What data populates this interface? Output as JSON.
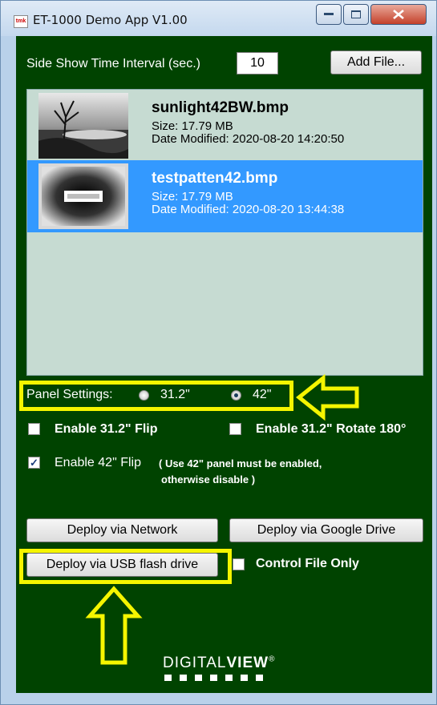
{
  "window": {
    "title": "ET-1000 Demo App V1.00",
    "app_icon_text": "tmk"
  },
  "interval": {
    "label": "Side Show Time Interval (sec.)",
    "value": "10"
  },
  "add_file_label": "Add File...",
  "files": [
    {
      "name": "sunlight42BW.bmp",
      "size": "Size: 17.79 MB",
      "date": "Date Modified: 2020-08-20 14:20:50",
      "selected": false
    },
    {
      "name": "testpatten42.bmp",
      "size": "Size: 17.79 MB",
      "date": "Date Modified: 2020-08-20 13:44:38",
      "selected": true
    }
  ],
  "panel": {
    "label": "Panel Settings:",
    "option_31": "31.2\"",
    "option_42": "42\"",
    "selected": "42\""
  },
  "options": {
    "flip31": {
      "label": "Enable 31.2\" Flip",
      "checked": false
    },
    "rotate31": {
      "label": "Enable 31.2\" Rotate 180°",
      "checked": false
    },
    "flip42": {
      "label": "Enable 42\" Flip",
      "checked": true
    },
    "flip42_note_1": "( Use 42\" panel must be enabled,",
    "flip42_note_2": "otherwise disable )"
  },
  "deploy": {
    "network": "Deploy via Network",
    "google": "Deploy via Google Drive",
    "usb": "Deploy via USB flash drive",
    "control_only": "Control File Only",
    "control_only_checked": false
  },
  "logo": {
    "text_light": "DIGITAL",
    "text_bold": "VIEW",
    "mark": "®"
  },
  "colors": {
    "client_bg": "#004300",
    "highlight": "#f5f500",
    "selection": "#3399ff"
  }
}
